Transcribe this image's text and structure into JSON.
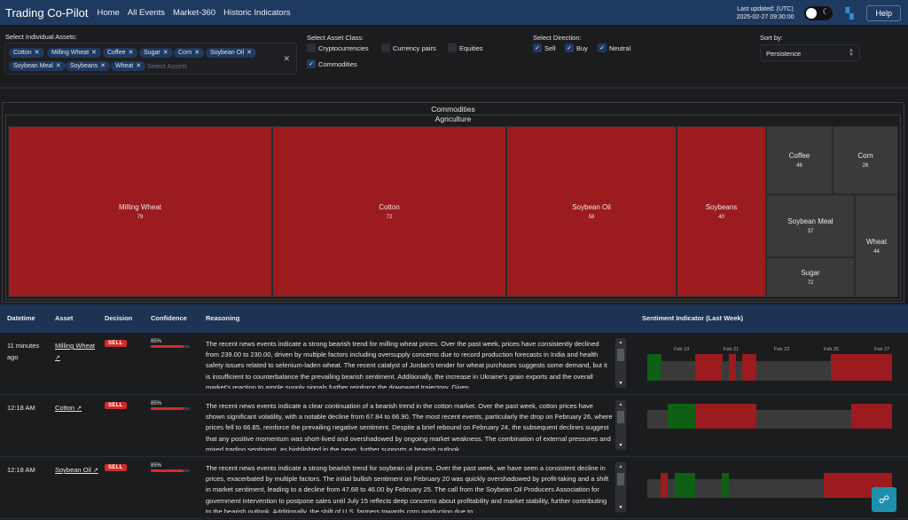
{
  "nav": {
    "brand": "Trading Co-Pilot",
    "links": [
      "Home",
      "All Events",
      "Market-360",
      "Historic Indicators"
    ],
    "updated_label": "Last updated: (UTC)",
    "updated_value": "2025-02-27 09:30:00",
    "help_label": "Help",
    "theme_icon": "moon-icon"
  },
  "filters": {
    "assets_label": "Select Individual Assets:",
    "assets_selected": [
      "Cotton",
      "Milling Wheat",
      "Coffee",
      "Sugar",
      "Corn",
      "Soybean Oil",
      "Soybean Meal",
      "Soybeans",
      "Wheat"
    ],
    "assets_placeholder": "Select Assets",
    "class_label": "Select Asset Class:",
    "classes": [
      {
        "label": "Cryptocurrencies",
        "checked": false
      },
      {
        "label": "Currency pairs",
        "checked": false
      },
      {
        "label": "Equities",
        "checked": false
      },
      {
        "label": "Commodities",
        "checked": true
      }
    ],
    "direction_label": "Select Direction:",
    "directions": [
      {
        "label": "Sell",
        "checked": true
      },
      {
        "label": "Buy",
        "checked": true
      },
      {
        "label": "Neutral",
        "checked": true
      }
    ],
    "sort_label": "Sort by:",
    "sort_value": "Persistence"
  },
  "treemap": {
    "root": "Commodities",
    "group": "Agriculture",
    "tiles": [
      {
        "name": "Milling Wheat",
        "value": 79,
        "direction": "sell"
      },
      {
        "name": "Cotton",
        "value": 72,
        "direction": "sell"
      },
      {
        "name": "Soybean Oil",
        "value": 58,
        "direction": "sell"
      },
      {
        "name": "Soybeans",
        "value": 40,
        "direction": "sell"
      },
      {
        "name": "Coffee",
        "value": 46,
        "direction": "neutral"
      },
      {
        "name": "Corn",
        "value": 26,
        "direction": "neutral"
      },
      {
        "name": "Soybean Meal",
        "value": 37,
        "direction": "neutral"
      },
      {
        "name": "Wheat",
        "value": 44,
        "direction": "neutral"
      },
      {
        "name": "Sugar",
        "value": 72,
        "direction": "neutral"
      }
    ]
  },
  "table": {
    "headers": [
      "Datetime",
      "Asset",
      "Decision",
      "Confidence",
      "Reasoning",
      "Sentiment Indicator (Last Week)"
    ],
    "sentiment_ticks": [
      "Feb 19",
      "Feb 21",
      "Feb 23",
      "Feb 25",
      "Feb 27"
    ],
    "rows": [
      {
        "datetime": "11 minutes ago",
        "asset": "Milling Wheat",
        "decision": "SELL",
        "confidence": "85%",
        "confidence_value": 0.85,
        "reasoning": "The recent news events indicate a strong bearish trend for milling wheat prices. Over the past week, prices have consistently declined from 239.00 to 230.00, driven by multiple factors including oversupply concerns due to record production forecasts in India and health safety issues related to selenium-laden wheat. The recent catalyst of Jordan's tender for wheat purchases suggests some demand, but it is insufficient to counterbalance the prevailing bearish sentiment. Additionally, the increase in Ukraine's grain exports and the overall market's reaction to ample supply signals further reinforce the downward trajectory. Given",
        "sentiment": [
          "buy",
          "buy",
          "neutral",
          "neutral",
          "neutral",
          "neutral",
          "neutral",
          "sell",
          "sell",
          "sell",
          "sell",
          "neutral",
          "sell",
          "neutral",
          "sell",
          "sell",
          "neutral",
          "neutral",
          "neutral",
          "neutral",
          "neutral",
          "neutral",
          "neutral",
          "neutral",
          "neutral",
          "neutral",
          "neutral",
          "sell",
          "sell",
          "sell",
          "sell",
          "sell",
          "sell",
          "sell",
          "sell",
          "sell"
        ]
      },
      {
        "datetime": "12:18 AM",
        "asset": "Cotton",
        "decision": "SELL",
        "confidence": "85%",
        "confidence_value": 0.85,
        "reasoning": "The recent news events indicate a clear continuation of a bearish trend in the cotton market. Over the past week, cotton prices have shown significant volatility, with a notable decline from 67.84 to 66.90. The most recent events, particularly the drop on February 26, where prices fell to 66.85, reinforce the prevailing negative sentiment. Despite a brief rebound on February 24, the subsequent declines suggest that any positive momentum was short-lived and overshadowed by ongoing market weakness. The combination of external pressures and mixed trading sentiment, as highlighted in the news, further supports a bearish outlook.",
        "sentiment": [
          "neutral",
          "neutral",
          "neutral",
          "buy",
          "buy",
          "buy",
          "buy",
          "sell",
          "sell",
          "sell",
          "sell",
          "sell",
          "sell",
          "sell",
          "sell",
          "sell",
          "neutral",
          "neutral",
          "neutral",
          "neutral",
          "neutral",
          "neutral",
          "neutral",
          "neutral",
          "neutral",
          "neutral",
          "neutral",
          "neutral",
          "neutral",
          "neutral",
          "sell",
          "sell",
          "sell",
          "sell",
          "sell",
          "sell"
        ]
      },
      {
        "datetime": "12:18 AM",
        "asset": "Soybean Oil",
        "decision": "SELL",
        "confidence": "85%",
        "confidence_value": 0.85,
        "reasoning": "The recent news events indicate a strong bearish trend for soybean oil prices. Over the past week, we have seen a consistent decline in prices, exacerbated by multiple factors. The initial bullish sentiment on February 20 was quickly overshadowed by profit-taking and a shift in market sentiment, leading to a decline from 47.68 to 46.00 by February 25. The call from the Soybean Oil Producers Association for government intervention to postpone sales until July 15 reflects deep concerns about profitability and market stability, further contributing to the bearish outlook. Additionally, the shift of U.S. farmers towards corn production due to",
        "sentiment": [
          "neutral",
          "neutral",
          "sell",
          "neutral",
          "buy",
          "buy",
          "buy",
          "neutral",
          "neutral",
          "neutral",
          "neutral",
          "buy",
          "neutral",
          "neutral",
          "neutral",
          "neutral",
          "neutral",
          "neutral",
          "neutral",
          "neutral",
          "neutral",
          "neutral",
          "neutral",
          "neutral",
          "neutral",
          "neutral",
          "sell",
          "sell",
          "sell",
          "sell",
          "sell",
          "sell",
          "sell",
          "sell",
          "sell",
          "sell"
        ]
      }
    ]
  },
  "colors": {
    "navbar": "#1f3a60",
    "sell": "#9b1b1e",
    "buy": "#0f5f14",
    "neutral": "#3a3a3a",
    "badge_sell": "#d42a2a",
    "fab": "#1f8fb0"
  },
  "fab_icon": "chat-support-icon"
}
